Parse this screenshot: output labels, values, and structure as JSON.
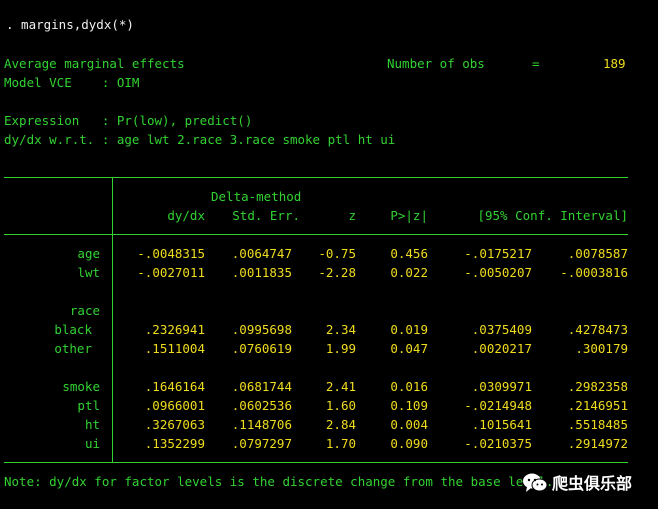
{
  "command": ". margins,dydx(*)",
  "header": {
    "title": "Average marginal effects",
    "nobs_label": "Number of obs",
    "nobs_eq": "=",
    "nobs_value": "189",
    "vce_label": "Model VCE    : OIM",
    "expression": "Expression   : Pr(low), predict()",
    "dydx_wrt": "dy/dx w.r.t. : age lwt 2.race 3.race smoke ptl ht ui"
  },
  "table": {
    "header_delta": "Delta-method",
    "columns": [
      "dy/dx",
      "Std. Err.",
      "z",
      "P>|z|",
      "[95% Conf. Interval]"
    ],
    "rows": [
      {
        "label": "age",
        "values": [
          "-.0048315",
          ".0064747",
          "-0.75",
          "0.456",
          "-.0175217",
          ".0078587"
        ]
      },
      {
        "label": "lwt",
        "values": [
          "-.0027011",
          ".0011835",
          "-2.28",
          "0.022",
          "-.0050207",
          "-.0003816"
        ]
      },
      {
        "label": "race",
        "values": [
          "",
          "",
          "",
          "",
          "",
          ""
        ]
      },
      {
        "label": "black",
        "values": [
          ".2326941",
          ".0995698",
          "2.34",
          "0.019",
          ".0375409",
          ".4278473"
        ]
      },
      {
        "label": "other",
        "values": [
          ".1511004",
          ".0760619",
          "1.99",
          "0.047",
          ".0020217",
          ".300179"
        ]
      },
      {
        "label": "smoke",
        "values": [
          ".1646164",
          ".0681744",
          "2.41",
          "0.016",
          ".0309971",
          ".2982358"
        ]
      },
      {
        "label": "ptl",
        "values": [
          ".0966001",
          ".0602536",
          "1.60",
          "0.109",
          "-.0214948",
          ".2146951"
        ]
      },
      {
        "label": "ht",
        "values": [
          ".3267063",
          ".1148706",
          "2.84",
          "0.004",
          ".1015641",
          ".5518485"
        ]
      },
      {
        "label": "ui",
        "values": [
          ".1352299",
          ".0797297",
          "1.70",
          "0.090",
          "-.0210375",
          ".2914972"
        ]
      }
    ]
  },
  "note": "Note: dy/dx for factor levels is the discrete change from the base level.",
  "watermark": {
    "text": "爬虫俱乐部",
    "icon": "wechat-bubble-icon"
  },
  "colors": {
    "background": "#000000",
    "command": "#f0f0f0",
    "label_green": "#32d232",
    "value_yellow": "#f0dc1e"
  }
}
